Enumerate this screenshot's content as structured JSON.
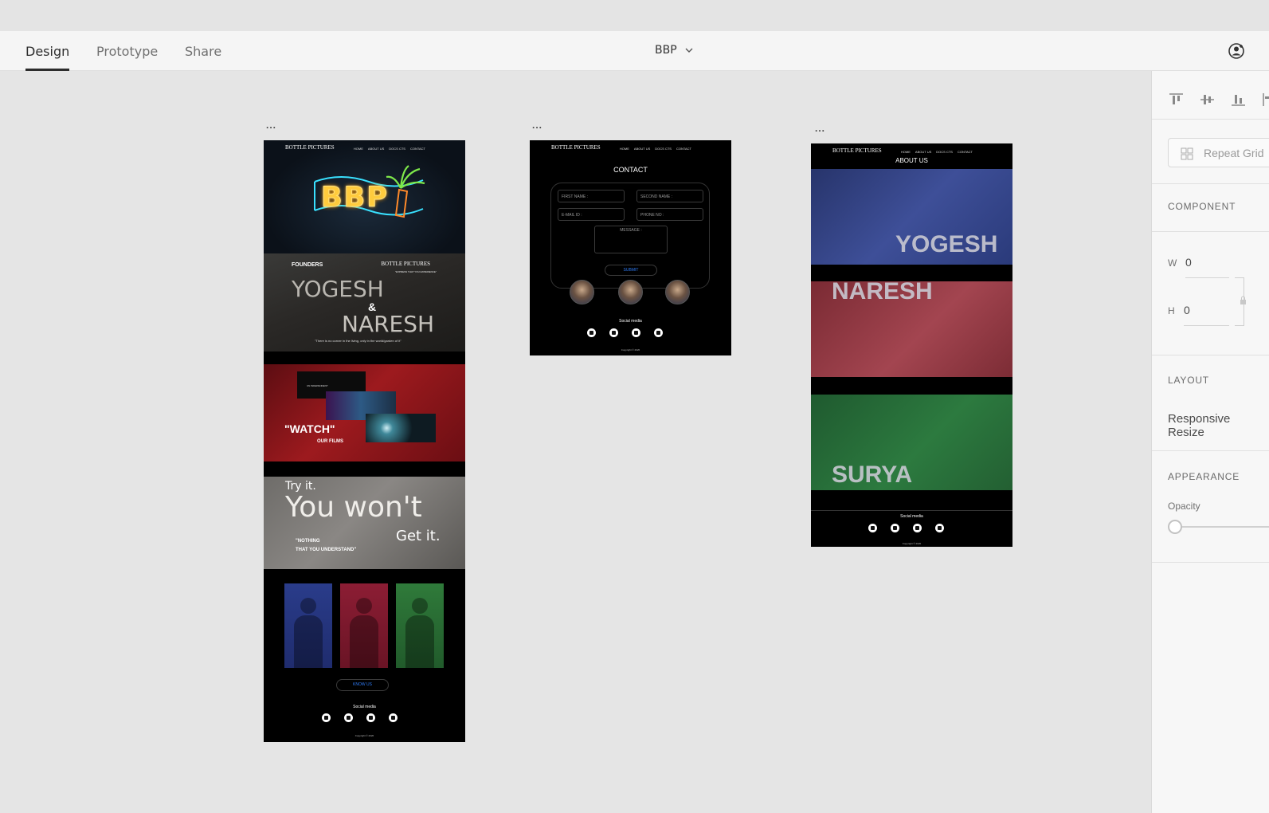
{
  "menubar": {
    "tabs": [
      {
        "label": "Design",
        "active": true
      },
      {
        "label": "Prototype",
        "active": false
      },
      {
        "label": "Share",
        "active": false
      }
    ],
    "document_title": "BBP",
    "icons": [
      "chevron-down-icon",
      "user-icon"
    ]
  },
  "canvas": {
    "artboard_menu": "...",
    "home": {
      "logo": "BOTTLE PICTURES",
      "nav": [
        "HOME",
        "ABOUT US",
        "DOCS CTS",
        "CONTACT"
      ],
      "hero_text": "BBP",
      "founders": {
        "label": "FOUNDERS",
        "logo": "BOTTLE PICTURES",
        "tagline": "\"EXPRESS THAT YOU EXPERIENCE\"",
        "name1": "YOGESH",
        "amp": "&",
        "name2": "NARESH",
        "quote": "\"There is no corner in the living, only in the world/garden of it\""
      },
      "watch": {
        "box_text": "UN INDEPENDENT",
        "title": "\"WATCH\"",
        "subtitle": "OUR FILMS"
      },
      "tryit": {
        "line1": "Try it.",
        "line2": "You won't",
        "line3": "Get it.",
        "quote1": "\"NOTHING",
        "quote2": "THAT YOU UNDERSTAND\""
      },
      "knowus": "KNOW US",
      "social_label": "Social media",
      "copyright": "Copyright © 2020"
    },
    "contact": {
      "logo": "BOTTLE PICTURES",
      "nav": [
        "HOME",
        "ABOUT US",
        "DOCS CTS",
        "CONTACT"
      ],
      "title": "CONTACT",
      "fields": {
        "first_name": "FIRST NAME :",
        "second_name": "SECOND NAME :",
        "email": "E-MAIL ID :",
        "phone": "PHONE NO :",
        "message": "MESSAGE :"
      },
      "submit": "SUBMIT",
      "social_label": "Social media",
      "copyright": "Copyright © 2020"
    },
    "about": {
      "logo": "BOTTLE PICTURES",
      "nav": [
        "HOME",
        "ABOUT US",
        "DOCS CTS",
        "CONTACT"
      ],
      "title": "ABOUT US",
      "names": [
        "YOGESH",
        "NARESH",
        "SURYA"
      ],
      "social_label": "Social media",
      "copyright": "Copyright © 2020"
    }
  },
  "panel": {
    "repeat_grid": "Repeat Grid",
    "component": "COMPONENT",
    "w_label": "W",
    "w_value": "0",
    "h_label": "H",
    "h_value": "0",
    "layout": "LAYOUT",
    "responsive_resize": "Responsive Resize",
    "appearance": "APPEARANCE",
    "opacity": "Opacity",
    "opacity_value": 0
  }
}
